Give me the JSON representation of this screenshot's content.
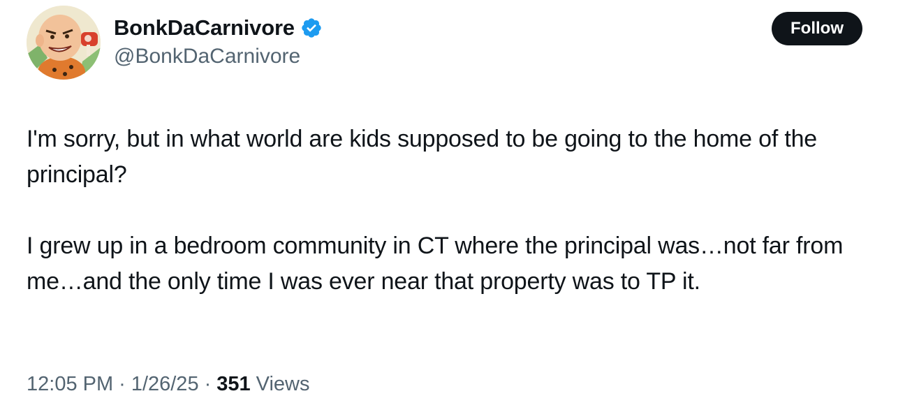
{
  "author": {
    "display_name": "BonkDaCarnivore",
    "handle": "@BonkDaCarnivore",
    "verified_icon": "verified-badge-icon",
    "verified_color": "#1d9bf0"
  },
  "follow_button": {
    "label": "Follow"
  },
  "tweet": {
    "paragraphs": [
      "I'm sorry, but in what world are kids supposed to be going to the home of the principal?",
      "I grew up in a bedroom community in CT where the principal was…not far from me…and the only time I was ever near that property was to TP it."
    ]
  },
  "meta": {
    "time": "12:05 PM",
    "date": "1/26/25",
    "separator": "·",
    "views_count": "351",
    "views_label": "Views"
  }
}
